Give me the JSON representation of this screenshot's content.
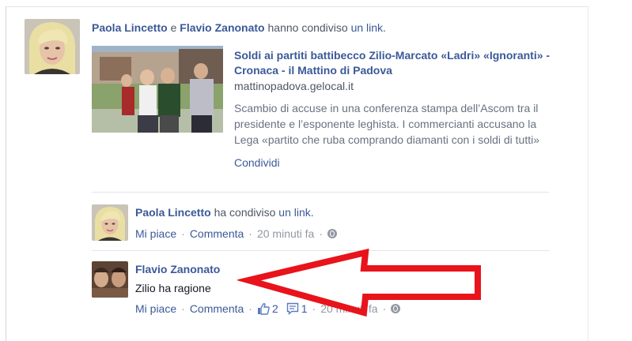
{
  "story": {
    "author1": "Paola Lincetto",
    "conjunction": "e",
    "author2": "Flavio Zanonato",
    "action": "hanno condiviso",
    "object": "un link."
  },
  "link": {
    "title": "Soldi ai partiti battibecco Zilio-Marcato «Ladri» «Ignoranti» - Cronaca - il Mattino di Padova",
    "domain": "mattinopadova.gelocal.it",
    "description": "Scambio di accuse in una conferenza stampa dell’Ascom tra il presidente e l’esponente leghista. I commercianti accusano la Lega «partito che ruba comprando diamanti con i soldi di tutti»",
    "share_label": "Condividi"
  },
  "share_entry": {
    "author": "Paola Lincetto",
    "action": "ha condiviso",
    "object": "un link.",
    "like_label": "Mi piace",
    "comment_label": "Comment­a",
    "time": "20 minuti fa",
    "privacy_icon": "globe-icon"
  },
  "comment": {
    "author": "Flavio Zanonato",
    "text": "Zilio ha ragione",
    "like_label": "Mi piace",
    "comment_label": "Commenta",
    "likes_count": "2",
    "comments_count": "1",
    "time": "20 minuti fa",
    "like_icon": "thumbs-up-icon",
    "comment_icon": "comment-bubble-icon",
    "privacy_icon": "globe-icon"
  },
  "annotation": {
    "arrow_color": "#e8131b",
    "arrow_icon": "left-arrow-icon"
  },
  "colors": {
    "link": "#3b5998",
    "muted": "#4e5665",
    "meta": "#9197a3",
    "text": "#141823"
  }
}
